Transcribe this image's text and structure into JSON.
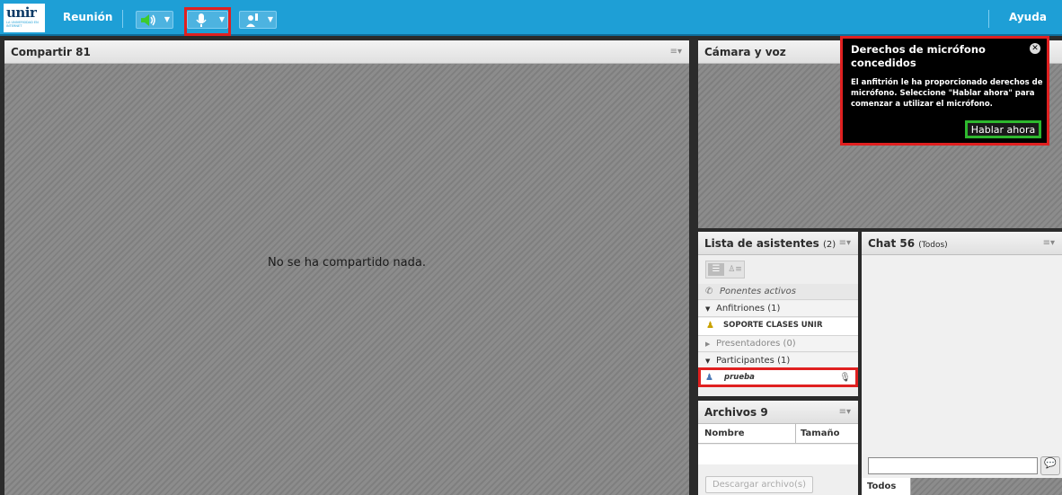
{
  "header": {
    "logo_text": "unir",
    "logo_sub": "LA UNIVERSIDAD EN INTERNET",
    "meeting_menu": "Reunión",
    "help_menu": "Ayuda",
    "icons": [
      "speaker-icon",
      "microphone-icon",
      "raise-hand-icon"
    ]
  },
  "share_pod": {
    "title": "Compartir 81",
    "empty_message": "No se ha compartido nada."
  },
  "camera_pod": {
    "title": "Cámara y voz"
  },
  "notification": {
    "title": "Derechos de micrófono concedidos",
    "message": "El anfitrión le ha proporcionado derechos de micrófono. Seleccione \"Hablar ahora\" para comenzar a utilizar el micrófono.",
    "action": "Hablar ahora"
  },
  "attendees_pod": {
    "title": "Lista de asistentes",
    "count": "(2)",
    "active_speakers": "Ponentes activos",
    "groups": [
      {
        "label": "Anfitriones (1)",
        "expanded": true,
        "members": [
          "SOPORTE CLASES UNIR"
        ]
      },
      {
        "label": "Presentadores (0)",
        "expanded": false,
        "members": []
      },
      {
        "label": "Participantes (1)",
        "expanded": true,
        "members": [
          "prueba"
        ]
      }
    ]
  },
  "files_pod": {
    "title": "Archivos 9",
    "columns": [
      "Nombre",
      "Tamaño"
    ],
    "download_button": "Descargar archivo(s)"
  },
  "chat_pod": {
    "title": "Chat 56",
    "scope": "(Todos)",
    "recipient_tab": "Todos",
    "input_value": ""
  },
  "colors": {
    "top_bar": "#1e9fd6",
    "highlight_red": "#e02020",
    "highlight_green": "#2eb82e",
    "notification_bg": "#000000"
  }
}
